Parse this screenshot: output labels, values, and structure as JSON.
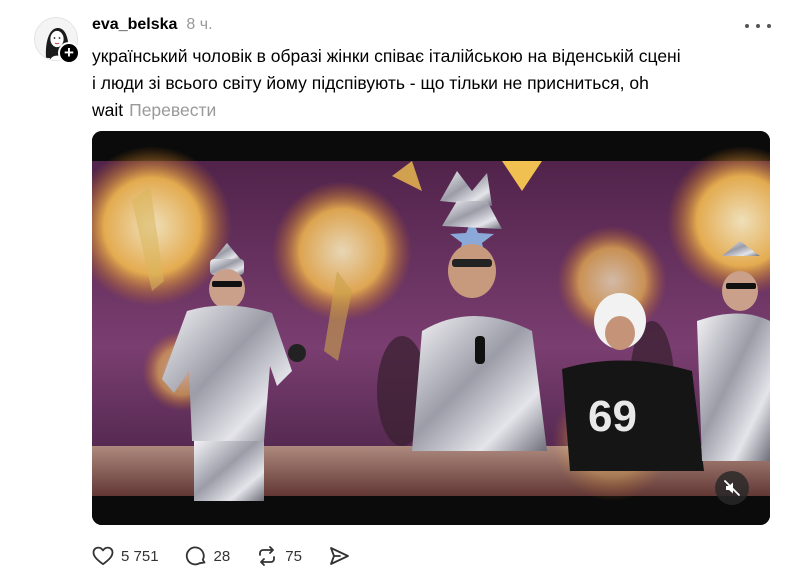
{
  "post": {
    "username": "eva_belska",
    "timestamp": "8 ч.",
    "text_lines": [
      "український чоловік в образі жінки співає італійською на віденській сцені",
      "і люди зі всього світу йому підспівують - що тільки не присниться, oh",
      "wait"
    ],
    "translate_label": "Перевести",
    "follow_symbol": "+"
  },
  "media": {
    "type": "video",
    "jersey_number": "69",
    "muted": true
  },
  "actions": {
    "likes": "5 751",
    "comments": "28",
    "reposts": "75"
  },
  "icons": {
    "like": "heart-icon",
    "comment": "comment-bubble-icon",
    "repost": "repost-icon",
    "share": "send-icon",
    "mute": "speaker-muted-icon",
    "more": "more-dots-icon"
  },
  "colors": {
    "text": "#000000",
    "muted_text": "#999999",
    "background": "#ffffff"
  }
}
